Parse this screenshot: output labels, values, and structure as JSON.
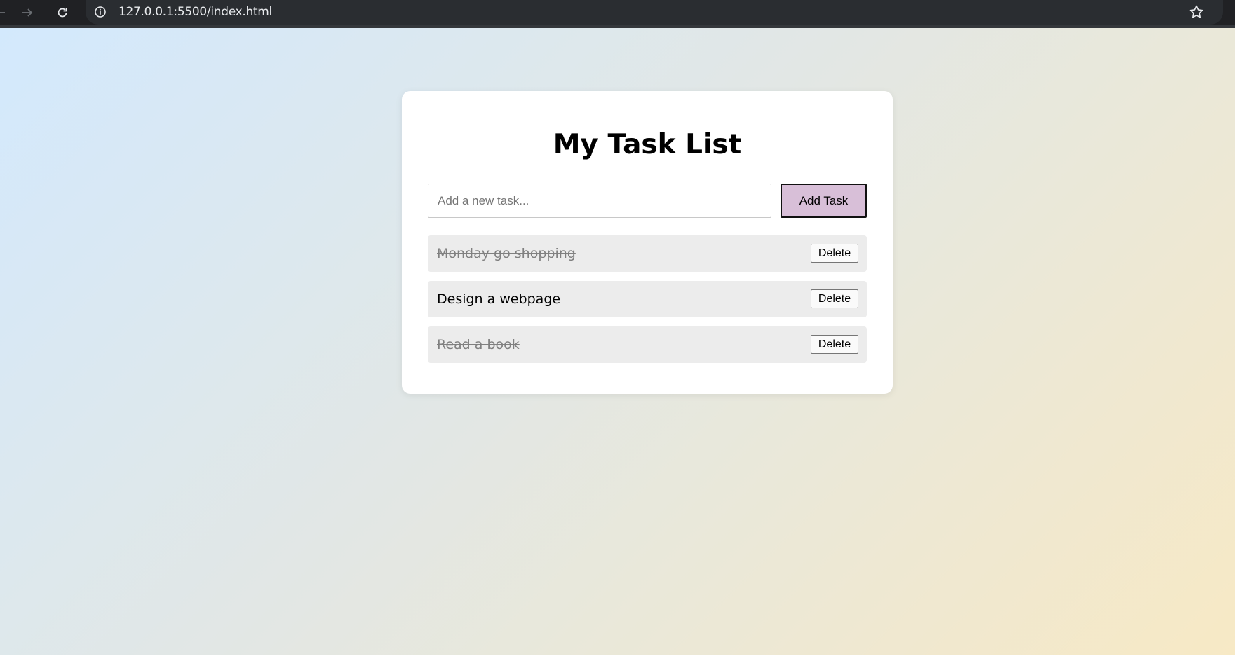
{
  "browser": {
    "url": "127.0.0.1:5500/index.html",
    "icons": [
      "back-arrow-icon",
      "forward-arrow-icon",
      "reload-icon",
      "info-icon",
      "bookmark-star-icon"
    ]
  },
  "app": {
    "title": "My Task List",
    "input_placeholder": "Add a new task...",
    "input_value": "",
    "add_button_label": "Add Task",
    "delete_button_label": "Delete",
    "tasks": [
      {
        "text": "Monday go shopping",
        "completed": true
      },
      {
        "text": "Design a webpage",
        "completed": false
      },
      {
        "text": "Read a book",
        "completed": true
      }
    ]
  },
  "colors": {
    "add_button_bg": "#d8bfd8",
    "task_item_bg": "#ececec",
    "completed_text": "#808080",
    "background_gradient_start": "#d3e9fd",
    "background_gradient_end": "#f7e9c5"
  }
}
